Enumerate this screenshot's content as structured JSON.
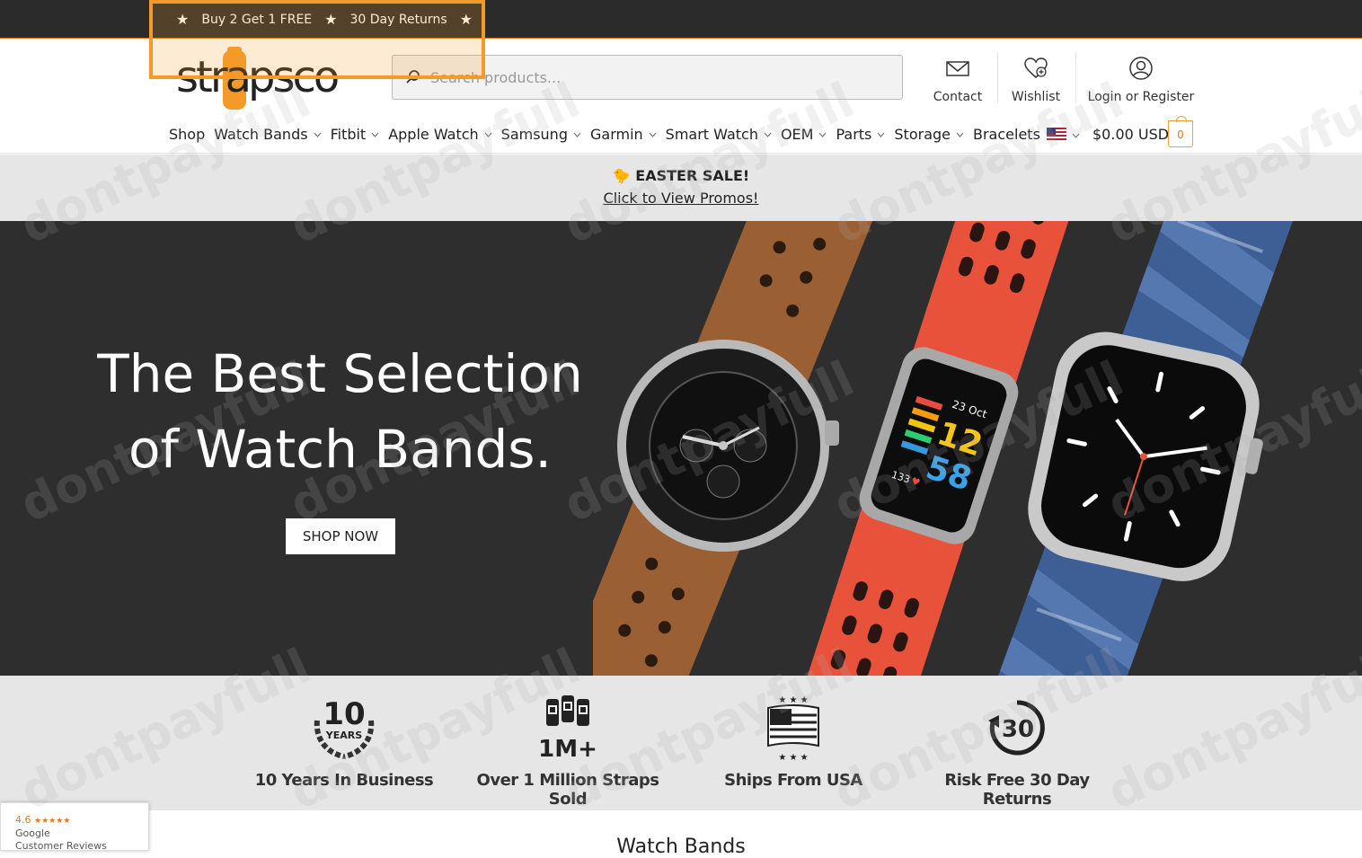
{
  "topbar": {
    "promo_1": "Buy 2 Get 1 FREE",
    "promo_2": "30 Day Returns",
    "star": "★"
  },
  "header": {
    "logo_text": "strapsco",
    "search_placeholder": "Search products...",
    "contact_label": "Contact",
    "wishlist_label": "Wishlist",
    "login_label": "Login or Register",
    "cart_total": "$0.00 USD",
    "cart_count": "0"
  },
  "nav": {
    "items": [
      {
        "label": "Shop"
      },
      {
        "label": "Watch Bands"
      },
      {
        "label": "Fitbit"
      },
      {
        "label": "Apple Watch"
      },
      {
        "label": "Samsung"
      },
      {
        "label": "Garmin"
      },
      {
        "label": "Smart Watch"
      },
      {
        "label": "OEM"
      },
      {
        "label": "Parts"
      },
      {
        "label": "Storage"
      },
      {
        "label": "Bracelets"
      }
    ]
  },
  "sale_bar": {
    "title": "🐤 EASTER SALE!",
    "link": "Click to View Promos!"
  },
  "hero": {
    "title_line1": "The Best Selection",
    "title_line2": "of Watch Bands.",
    "button": "SHOP NOW",
    "fitbit_date": "23 Oct",
    "fitbit_hour": "12",
    "fitbit_min": "58",
    "fitbit_hr": "133"
  },
  "features": [
    {
      "icon": "10",
      "sub": "YEARS",
      "label": "10 Years In Business"
    },
    {
      "icon": "1M+",
      "label": "Over 1 Million Straps Sold"
    },
    {
      "icon": "usa-flag",
      "label": "Ships From USA"
    },
    {
      "icon": "30",
      "label": "Risk Free 30 Day Returns"
    }
  ],
  "section_title": "Watch Bands",
  "google_badge": {
    "rating": "4.6",
    "stars": "★★★★★",
    "brand": "Google",
    "caption": "Customer Reviews"
  },
  "watermark": "dontpayfull",
  "colors": {
    "accent": "#e07a1c",
    "topbar_bg": "#2b2b2b",
    "hero_bg": "#2e2e2e",
    "band_bg": "#e6e6e6"
  }
}
